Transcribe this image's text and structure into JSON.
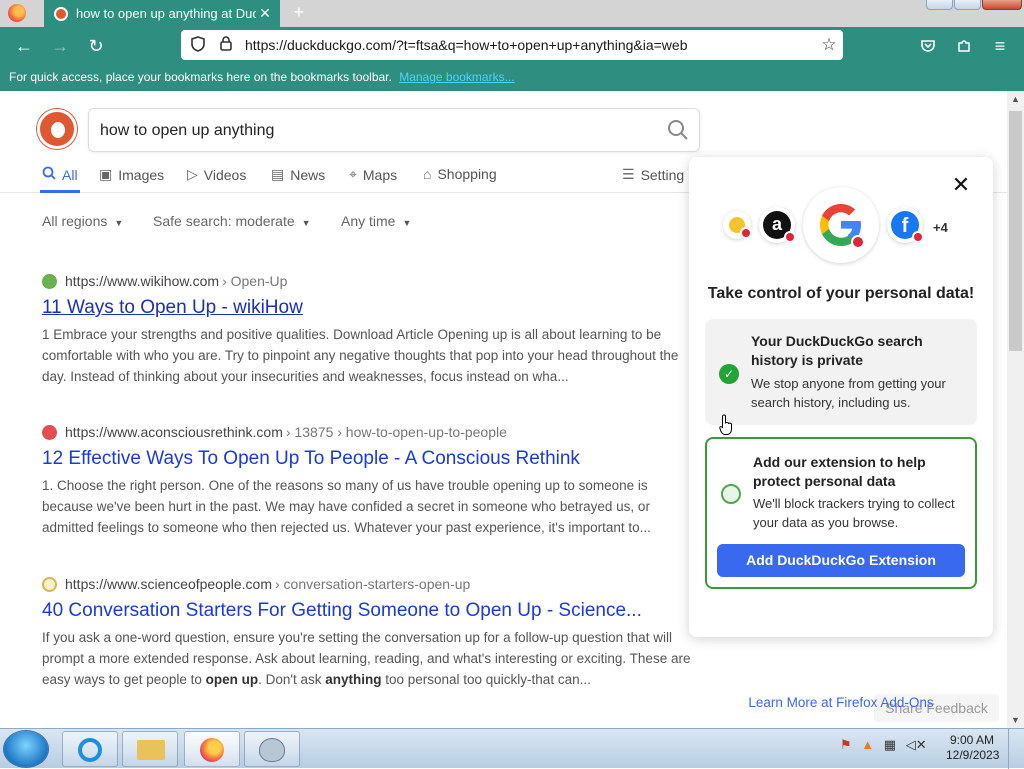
{
  "browser": {
    "tab_title": "how to open up anything at DuckDuckGo",
    "tab_close": "✕",
    "new_tab": "+",
    "url": "https://duckduckgo.com/?t=ftsa&q=how+to+open+up+anything&ia=web",
    "bookmarks_hint": "For quick access, place your bookmarks here on the bookmarks toolbar.",
    "manage_bookmarks": "Manage bookmarks..."
  },
  "search": {
    "query": "how to open up anything"
  },
  "tabs": [
    {
      "label": "All",
      "icon": "search-icon"
    },
    {
      "label": "Images",
      "icon": "image-icon"
    },
    {
      "label": "Videos",
      "icon": "play-icon"
    },
    {
      "label": "News",
      "icon": "newspaper-icon"
    },
    {
      "label": "Maps",
      "icon": "map-pin-icon"
    },
    {
      "label": "Shopping",
      "icon": "shopping-bag-icon"
    },
    {
      "label": "Setting",
      "icon": "sliders-icon"
    }
  ],
  "filters": {
    "region": "All regions",
    "safe_search": "Safe search: moderate",
    "time": "Any time"
  },
  "results": [
    {
      "domain": "https://www.wikihow.com",
      "path": "› Open-Up",
      "title": "11 Ways to Open Up - wikiHow",
      "snippet": "1 Embrace your strengths and positive qualities. Download Article Opening up is all about learning to be comfortable with who you are. Try to pinpoint any negative thoughts that pop into your head throughout the day. Instead of thinking about your insecurities and weaknesses, focus instead on wha..."
    },
    {
      "domain": "https://www.aconsciousrethink.com",
      "path": "› 13875 › how-to-open-up-to-people",
      "title": "12 Effective Ways To Open Up To People - A Conscious Rethink",
      "snippet": "1. Choose the right person. One of the reasons so many of us have trouble opening up to someone is because we've been hurt in the past. We may have confided a secret in someone who betrayed us, or admitted feelings to someone who then rejected us. Whatever your past experience, it's important to..."
    },
    {
      "domain": "https://www.scienceofpeople.com",
      "path": "› conversation-starters-open-up",
      "title": "40 Conversation Starters For Getting Someone to Open Up - Science...",
      "snippet_parts": [
        "If you ask a one-word question, ensure you're setting the conversation up for a follow-up question that will prompt a more extended response. Ask about learning, reading, and what's interesting or exciting. These are easy ways to get people to ",
        "open up",
        ". Don't ask ",
        "anything",
        " too personal too quickly-that can..."
      ]
    }
  ],
  "share_feedback": "Share Feedback",
  "popover": {
    "close": "✕",
    "more_count": "+4",
    "heading": "Take control of your personal data!",
    "card1_title": "Your DuckDuckGo search history is private",
    "card1_body": "We stop anyone from getting your search history, including us.",
    "card2_title": "Add our extension to help protect personal data",
    "card2_body": "We'll block trackers trying to collect your data as you browse.",
    "add_button": "Add DuckDuckGo Extension",
    "learn_more": "Learn More at Firefox Add-Ons"
  },
  "taskbar": {
    "time": "9:00 AM",
    "date": "12/9/2023"
  },
  "colors": {
    "chrome": "#2e8f81",
    "accent": "#3969ef",
    "ddg_orange": "#de5833",
    "success_green": "#21a336"
  }
}
